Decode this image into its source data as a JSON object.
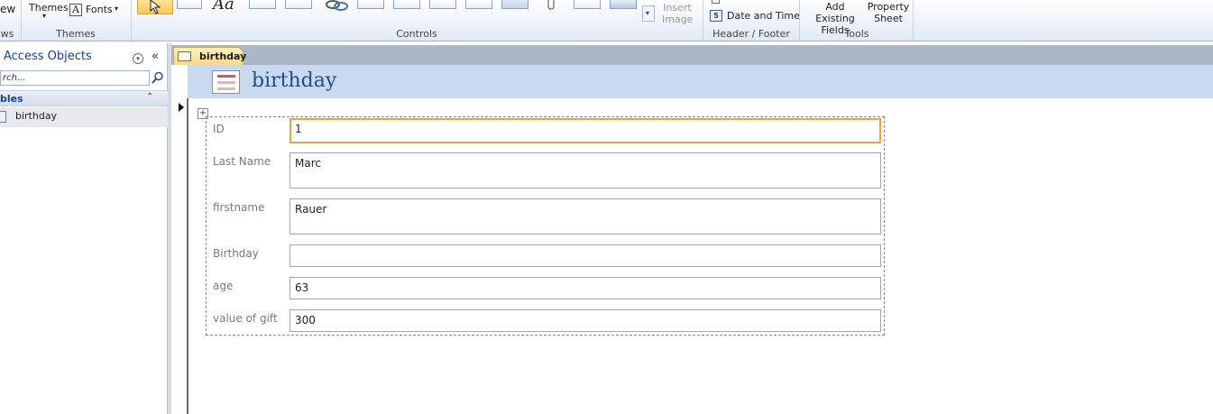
{
  "ribbon": {
    "partial_left_text": "ew",
    "partial_left_group": "ws",
    "themes_label": "Themes",
    "fonts_label": "Fonts",
    "fonts_glyph": "A",
    "themes_group": "Themes",
    "controls_group": "Controls",
    "insert_image_label": "Insert Image",
    "date_time_label": "Date and Time",
    "header_footer_group": "Header / Footer",
    "add_existing_fields_label": "Add Existing Fields",
    "property_sheet_label": "Property Sheet",
    "tools_group": "Tools",
    "aa_glyph": "Aa"
  },
  "nav": {
    "title": "Access Objects",
    "search_placeholder": "rch...",
    "group_label": "bles",
    "items": [
      {
        "label": "birthday"
      }
    ]
  },
  "document": {
    "tab_label": "birthday",
    "form_title": "birthday"
  },
  "form": {
    "fields": [
      {
        "label": "ID",
        "value": "1"
      },
      {
        "label": "Last Name",
        "value": "Marc"
      },
      {
        "label": "firstname",
        "value": "Rauer"
      },
      {
        "label": "Birthday",
        "value": ""
      },
      {
        "label": "age",
        "value": "63"
      },
      {
        "label": "value of gift",
        "value": "300"
      }
    ]
  },
  "colors": {
    "accent": "#15428b",
    "focus_border": "#f0a33c",
    "header_band": "#c9daf0",
    "tab_active": "#ffd780"
  }
}
